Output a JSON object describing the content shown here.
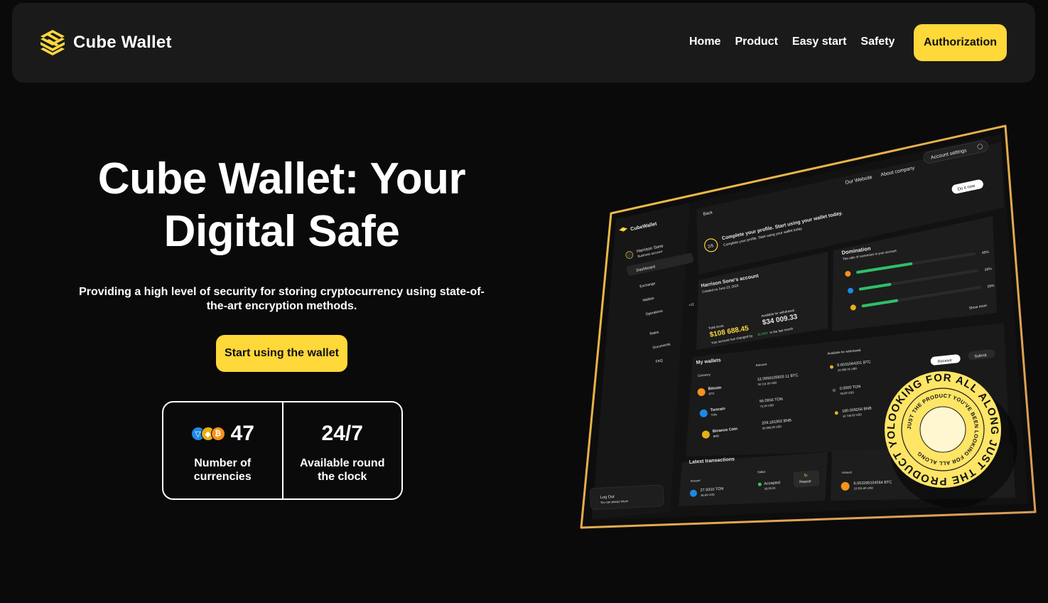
{
  "brand": {
    "name": "Cube Wallet",
    "accent": "#ffd83a"
  },
  "nav": {
    "items": [
      {
        "label": "Home"
      },
      {
        "label": "Product"
      },
      {
        "label": "Easy start"
      },
      {
        "label": "Safety"
      }
    ],
    "auth_label": "Authorization"
  },
  "hero": {
    "title_line1": "Cube Wallet: Your",
    "title_line2": "Digital Safe",
    "subtitle": "Providing a high level of security for storing cryptocurrency using state-of-the-art encryption methods.",
    "cta_label": "Start using the wallet"
  },
  "stats": [
    {
      "value": "47",
      "label_line1": "Number of",
      "label_line2": "currencies",
      "icons": [
        "ton-icon",
        "bnb-icon",
        "bitcoin-icon"
      ]
    },
    {
      "value": "24/7",
      "label_line1": "Available round",
      "label_line2": "the clock"
    }
  ],
  "device": {
    "top_links": [
      "Our Website",
      "About company",
      "Account settings"
    ],
    "do_it_now": "Do it now",
    "back": "Back",
    "app_name": "CubeWallet",
    "user_name": "Harrison Sone",
    "user_role": "Business account",
    "sidebar": [
      "Dashboard",
      "Exchange",
      "Wallets",
      "Operations",
      "Rates",
      "Documents",
      "FAQ"
    ],
    "ops_badge": "+12",
    "logout": "Log Out",
    "logout_sub": "You can always return",
    "progress": "2/5",
    "complete_title": "Complete your profile. Start using your wallet today.",
    "complete_sub": "Complete your profile. Start using your wallet today",
    "account_title": "Harrison Sone's account",
    "account_created": "Created on June 23, 2023",
    "total_label": "Total score",
    "total_value": "$108 688.45",
    "available_label": "Available for withdrawal",
    "available_value": "$34 009.33",
    "change_note": "Your account has changed by",
    "change_pct": "16.06%",
    "change_note2": "in the last month",
    "domination_title": "Domination",
    "domination_sub": "The ratio of currencies in your account",
    "domination": [
      "45%",
      "26%",
      "29%"
    ],
    "show_more": "Show more",
    "wallets_title": "My wallets",
    "col_currency": "Currency",
    "col_amount": "Amount",
    "col_available": "Available for withdrawal",
    "wallets": [
      {
        "name": "Bitcoin",
        "ticker": "BTC",
        "amount": "12.0956105603 11 BTC",
        "amount_usd": "30 114.30 USD",
        "avail": "8.6031064201 BTC",
        "avail_usd": "24 009.76 USD"
      },
      {
        "name": "Toncoin",
        "ticker": "TON",
        "amount": "56.0956 TON",
        "amount_usd": "72.28 USD",
        "avail": "0.0000 TON",
        "avail_usd": "00.00 USD"
      },
      {
        "name": "Binance Coin",
        "ticker": "BNB",
        "amount": "209.181902 BNB",
        "amount_usd": "50 895.68 USD",
        "avail": "180.009256 BNB",
        "avail_usd": "43 740.02 USD"
      }
    ],
    "receive": "Receive",
    "submit": "Submit",
    "latest_title": "Latest transactions",
    "tx": {
      "amount_label": "Amount",
      "amount": "27.9310 TON",
      "amount_usd": "36.84 USD",
      "status_label": "Status",
      "status": "Accepted",
      "status_date": "18.09.23",
      "repeat": "Repeat",
      "amount2": "6.053295104564 BTC",
      "amount2_usd": "15 621.80 USD"
    },
    "badge_outer": "LOOKING FOR ALL ALONG JUST THE PRODUCT YOU'VE BEEN",
    "badge_inner": "JUST THE PRODUCT YOU'VE BEEN LOOKING FOR ALL ALONG"
  }
}
